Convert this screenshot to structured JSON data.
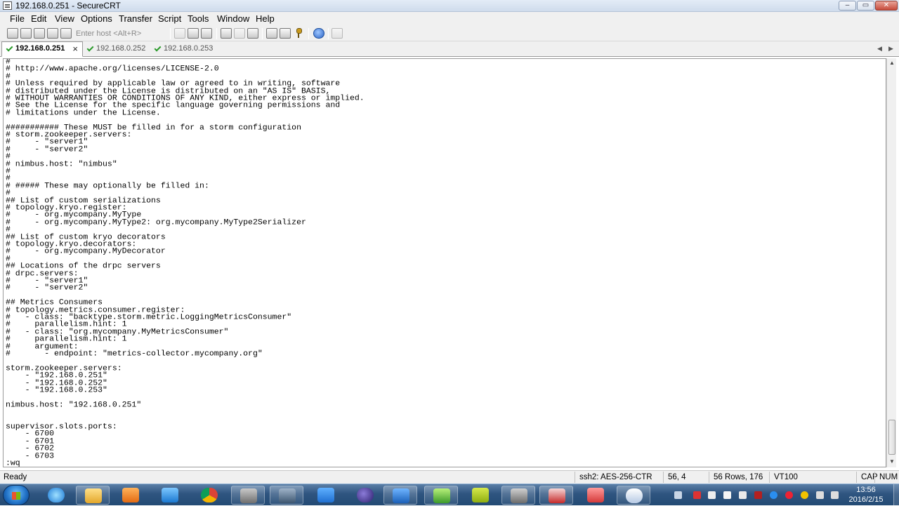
{
  "window": {
    "title": "192.168.0.251 - SecureCRT",
    "controls": {
      "minimize": "–",
      "maximize": "▭",
      "close": "✕"
    }
  },
  "menubar": {
    "items": [
      "File",
      "Edit",
      "View",
      "Options",
      "Transfer",
      "Script",
      "Tools",
      "Window",
      "Help"
    ]
  },
  "toolbar": {
    "host_placeholder": "Enter host <Alt+R>",
    "icons": [
      "connect-icon",
      "quick-connect-icon",
      "connect-in-tab-icon",
      "reconnect-icon",
      "disconnect-icon",
      "copy-icon",
      "paste-icon",
      "find-icon",
      "print-icon",
      "print-selection-icon",
      "print-setup-icon",
      "session-options-icon",
      "global-options-icon",
      "keymap-icon",
      "help-icon",
      "sftp-icon"
    ]
  },
  "tabs": {
    "items": [
      {
        "label": "192.168.0.251",
        "active": true
      },
      {
        "label": "192.168.0.252",
        "active": false
      },
      {
        "label": "192.168.0.253",
        "active": false
      }
    ],
    "close_glyph": "×",
    "scroll_left": "◀",
    "scroll_right": "▶"
  },
  "terminal": {
    "lines": [
      "#",
      "# http://www.apache.org/licenses/LICENSE-2.0",
      "#",
      "# Unless required by applicable law or agreed to in writing, software",
      "# distributed under the License is distributed on an \"AS IS\" BASIS,",
      "# WITHOUT WARRANTIES OR CONDITIONS OF ANY KIND, either express or implied.",
      "# See the License for the specific language governing permissions and",
      "# limitations under the License.",
      "",
      "########### These MUST be filled in for a storm configuration",
      "# storm.zookeeper.servers:",
      "#     - \"server1\"",
      "#     - \"server2\"",
      "#",
      "# nimbus.host: \"nimbus\"",
      "#",
      "#",
      "# ##### These may optionally be filled in:",
      "#",
      "## List of custom serializations",
      "# topology.kryo.register:",
      "#     - org.mycompany.MyType",
      "#     - org.mycompany.MyType2: org.mycompany.MyType2Serializer",
      "#",
      "## List of custom kryo decorators",
      "# topology.kryo.decorators:",
      "#     - org.mycompany.MyDecorator",
      "#",
      "## Locations of the drpc servers",
      "# drpc.servers:",
      "#     - \"server1\"",
      "#     - \"server2\"",
      "",
      "## Metrics Consumers",
      "# topology.metrics.consumer.register:",
      "#   - class: \"backtype.storm.metric.LoggingMetricsConsumer\"",
      "#     parallelism.hint: 1",
      "#   - class: \"org.mycompany.MyMetricsConsumer\"",
      "#     parallelism.hint: 1",
      "#     argument:",
      "#       - endpoint: \"metrics-collector.mycompany.org\"",
      "",
      "storm.zookeeper.servers:",
      "    - \"192.168.0.251\"",
      "    - \"192.168.0.252\"",
      "    - \"192.168.0.253\"",
      "",
      "nimbus.host: \"192.168.0.251\"",
      "",
      "",
      "supervisor.slots.ports:",
      "    - 6700",
      "    - 6701",
      "    - 6702",
      "    - 6703",
      ":wq"
    ]
  },
  "statusbar": {
    "status": "Ready",
    "encryption": "ssh2: AES-256-CTR",
    "cursor": "56,  4",
    "size": "56 Rows, 176 Cols",
    "emulation": "VT100",
    "caps": "CAP",
    "num": "NUM"
  },
  "taskbar": {
    "apps": [
      "internet-explorer-icon",
      "file-explorer-icon",
      "media-player-icon",
      "network-app-icon",
      "chrome-icon",
      "toolbox-icon",
      "briefcase-tool-icon",
      "notes-icon",
      "eclipse-icon",
      "virtualbox-icon",
      "pycharm-icon",
      "memory-analyzer-icon",
      "securecrt-icon",
      "foxit-reader-icon",
      "eraser-app-icon",
      "dubbo-icon"
    ],
    "clock_time": "13:56",
    "clock_date": "2016/2/15"
  }
}
